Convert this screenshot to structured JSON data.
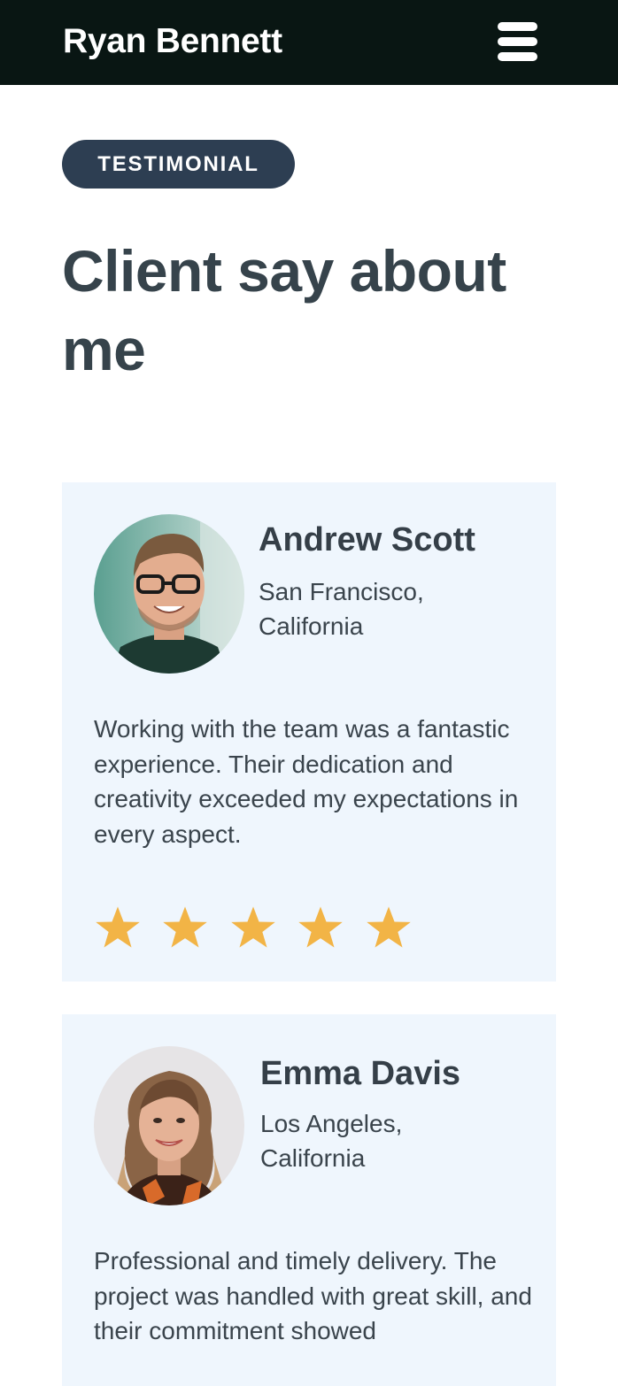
{
  "header": {
    "brand": "Ryan Bennett",
    "menu_icon": "hamburger-menu-icon"
  },
  "section": {
    "tag": "TESTIMONIAL",
    "title": "Client say about me"
  },
  "testimonials": [
    {
      "name": "Andrew Scott",
      "location": "San Francisco, California",
      "quote": "Working with the team was a fantastic experience. Their dedication and creativity exceeded my expectations in every aspect.",
      "rating": 5,
      "rating_max": 5
    },
    {
      "name": "Emma Davis",
      "location": "Los Angeles, California",
      "quote": "Professional and timely delivery. The project was handled with great skill, and their commitment showed"
    }
  ],
  "colors": {
    "header_bg": "#091613",
    "tag_bg": "#2d3e52",
    "heading_text": "#36434b",
    "card_bg": "#eff6fd",
    "star": "#f2b446"
  }
}
